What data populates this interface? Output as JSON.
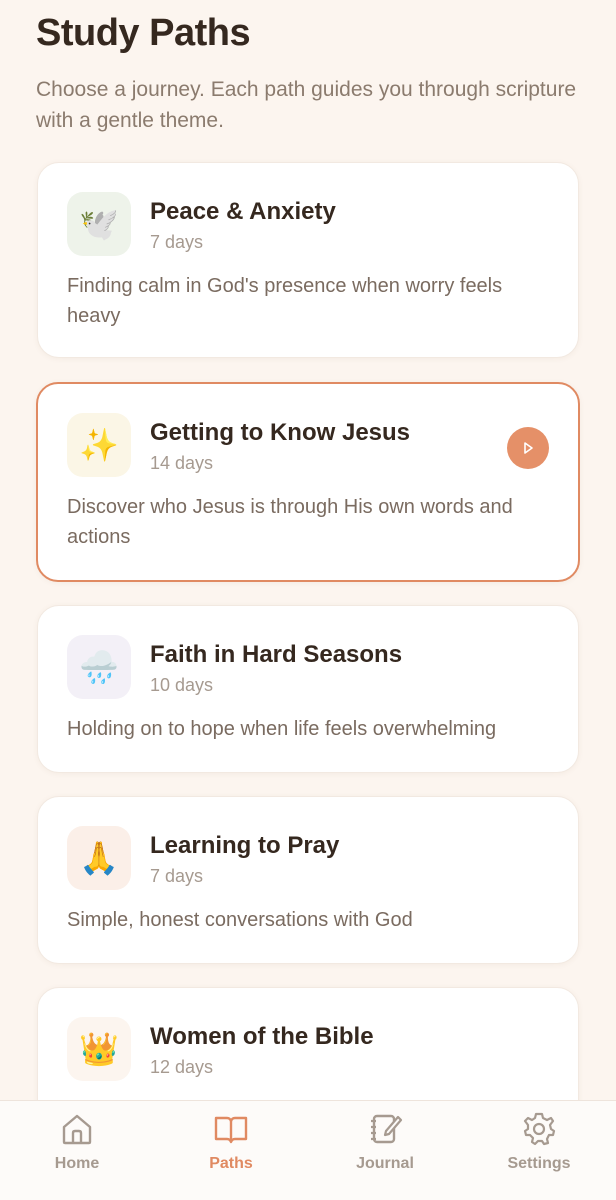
{
  "header": {
    "title": "Study Paths",
    "subtitle": "Choose a journey. Each path guides you through scripture with a gentle theme."
  },
  "paths": [
    {
      "icon": "dove-icon",
      "emoji": "🕊️",
      "title": "Peace & Anxiety",
      "days": "7 days",
      "description": "Finding calm in God's presence when worry feels heavy",
      "icon_bg": "#eef3ea"
    },
    {
      "icon": "sparkles-icon",
      "emoji": "✨",
      "title": "Getting to Know Jesus",
      "days": "14 days",
      "description": "Discover who Jesus is through His own words and actions",
      "icon_bg": "#fbf6e6",
      "active": true
    },
    {
      "icon": "rain-cloud-icon",
      "emoji": "🌧️",
      "title": "Faith in Hard Seasons",
      "days": "10 days",
      "description": "Holding on to hope when life feels overwhelming",
      "icon_bg": "#f3f0f7"
    },
    {
      "icon": "praying-hands-icon",
      "emoji": "🙏",
      "title": "Learning to Pray",
      "days": "7 days",
      "description": "Simple, honest conversations with God",
      "icon_bg": "#fbefe8"
    },
    {
      "icon": "crown-icon",
      "emoji": "👑",
      "title": "Women of the Bible",
      "days": "12 days",
      "description": "",
      "icon_bg": "#fcf5ef"
    }
  ],
  "tabbar": {
    "items": [
      {
        "label": "Home",
        "icon": "home-icon"
      },
      {
        "label": "Paths",
        "icon": "book-icon",
        "active": true
      },
      {
        "label": "Journal",
        "icon": "journal-icon"
      },
      {
        "label": "Settings",
        "icon": "gear-icon"
      }
    ]
  },
  "colors": {
    "accent": "#e08a62",
    "background": "#fcf5ef",
    "muted_text": "#a69a90"
  }
}
